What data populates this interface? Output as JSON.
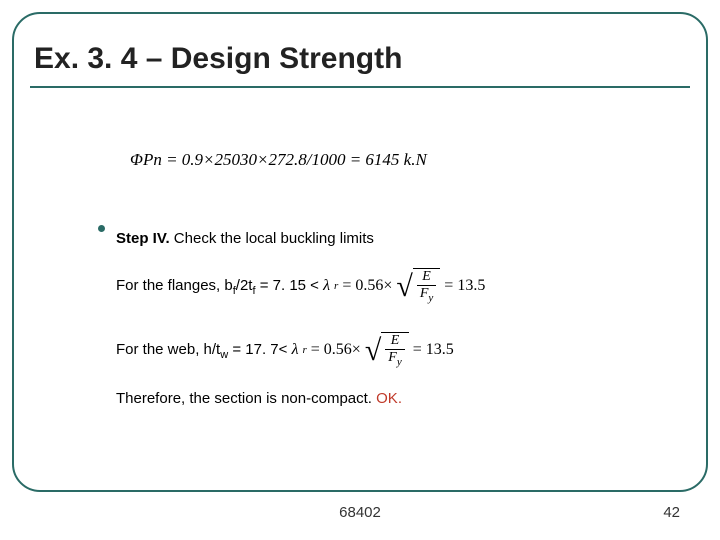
{
  "title": "Ex. 3. 4 – Design Strength",
  "eq_top": "ΦPn = 0.9×25030×272.8/1000 = 6145 k.N",
  "step": {
    "label": "Step IV.",
    "text": " Check the local buckling limits"
  },
  "flanges": {
    "prefix": "For the flanges, b",
    "sub1": "f",
    "mid1": "/2t",
    "sub2": "f",
    "mid2": " = 7. 15 < ",
    "lambda": "λ",
    "lambda_sub": "r",
    "eq": " = 0.56×",
    "E": "E",
    "Fy": "F",
    "Fy_sub": "y",
    "result": " = 13.5"
  },
  "web": {
    "prefix": "For the web, h/t",
    "sub1": "w",
    "mid": " = 17. 7< ",
    "lambda": "λ",
    "lambda_sub": "r",
    "eq": " = 0.56×",
    "E": "E",
    "Fy": "F",
    "Fy_sub": "y",
    "result": " = 13.5"
  },
  "therefore": {
    "text": "Therefore, the section is non-compact. ",
    "ok": "OK."
  },
  "footer": {
    "center": "68402",
    "right": "42"
  }
}
